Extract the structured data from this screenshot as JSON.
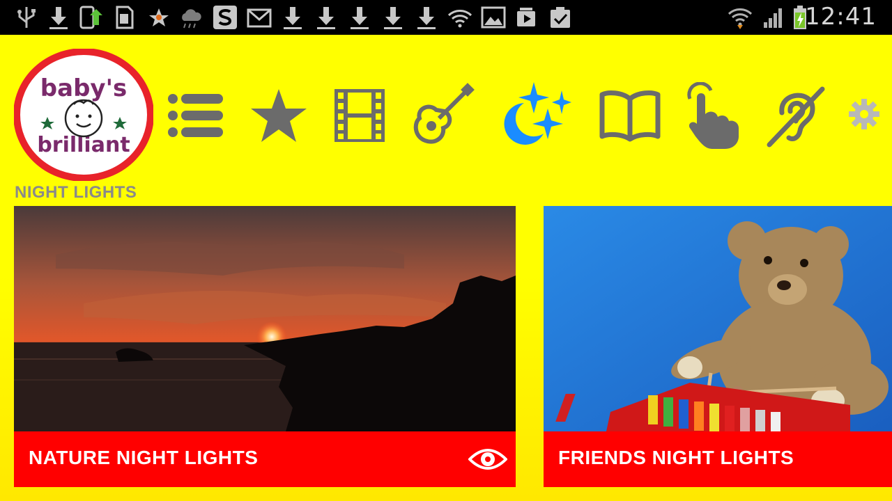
{
  "status_bar": {
    "left_icons": [
      "usb-icon",
      "download-icon",
      "phone-sync-icon",
      "sd-card-icon",
      "star-notification-icon",
      "cloud-rain-icon",
      "app-s-icon",
      "gmail-icon",
      "download-icon",
      "download-icon",
      "download-icon",
      "download-icon",
      "download-icon",
      "wifi-question-icon",
      "gallery-icon",
      "media-icon",
      "clipboard-check-icon"
    ],
    "right_icons": [
      "wifi-icon",
      "signal-icon",
      "battery-charging-icon"
    ],
    "time": "12:41"
  },
  "logo": {
    "line1": "baby's",
    "line2": "brilliant"
  },
  "section_title": "NIGHT LIGHTS",
  "nav": [
    {
      "id": "list",
      "icon": "list-icon"
    },
    {
      "id": "favorites",
      "icon": "star-icon"
    },
    {
      "id": "videos",
      "icon": "film-icon"
    },
    {
      "id": "music",
      "icon": "guitar-icon"
    },
    {
      "id": "night-lights",
      "icon": "moon-stars-icon",
      "active": true
    },
    {
      "id": "books",
      "icon": "book-icon"
    },
    {
      "id": "touch",
      "icon": "touch-hand-icon"
    },
    {
      "id": "hearing",
      "icon": "ear-icon"
    },
    {
      "id": "settings",
      "icon": "gear-icon"
    }
  ],
  "colors": {
    "background": "#ffff00",
    "accent": "#1a8cff",
    "nav_icon": "#6b6b6b",
    "card_bar": "#ff0000"
  },
  "cards": [
    {
      "label": "NATURE NIGHT LIGHTS",
      "has_eye": true
    },
    {
      "label": "FRIENDS NIGHT LIGHTS",
      "has_eye": false
    }
  ]
}
